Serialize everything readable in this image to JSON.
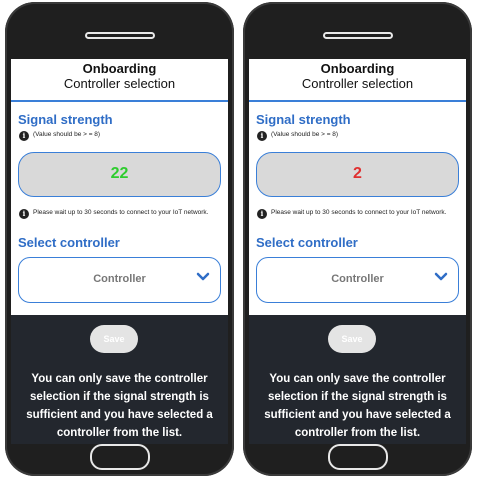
{
  "screens": [
    {
      "header": {
        "title": "Onboarding",
        "subtitle": "Controller selection"
      },
      "signal": {
        "title": "Signal strength",
        "hint": "(Value should be > = 8)",
        "value": "22",
        "value_color": "#2ecc2e"
      },
      "wait_hint": "Please wait up to 30 seconds to connect to your IoT network.",
      "controller": {
        "title": "Select controller",
        "selected": "Controller"
      },
      "save_label": "Save",
      "footer_text": "You can only save the controller selection if the signal strength is sufficient and you have selected a controller from the list."
    },
    {
      "header": {
        "title": "Onboarding",
        "subtitle": "Controller selection"
      },
      "signal": {
        "title": "Signal strength",
        "hint": "(Value should be > = 8)",
        "value": "2",
        "value_color": "#e03030"
      },
      "wait_hint": "Please wait up to 30 seconds to connect to your IoT network.",
      "controller": {
        "title": "Select controller",
        "selected": "Controller"
      },
      "save_label": "Save",
      "footer_text": "You can only save the controller selection if the signal strength is sufficient and you have selected a controller from the list."
    }
  ],
  "colors": {
    "accent": "#2f6dc6",
    "border": "#3a7fd8",
    "footer_bg": "#23272e"
  },
  "icons": {
    "info": "info-icon",
    "chevron": "chevron-down-icon"
  }
}
